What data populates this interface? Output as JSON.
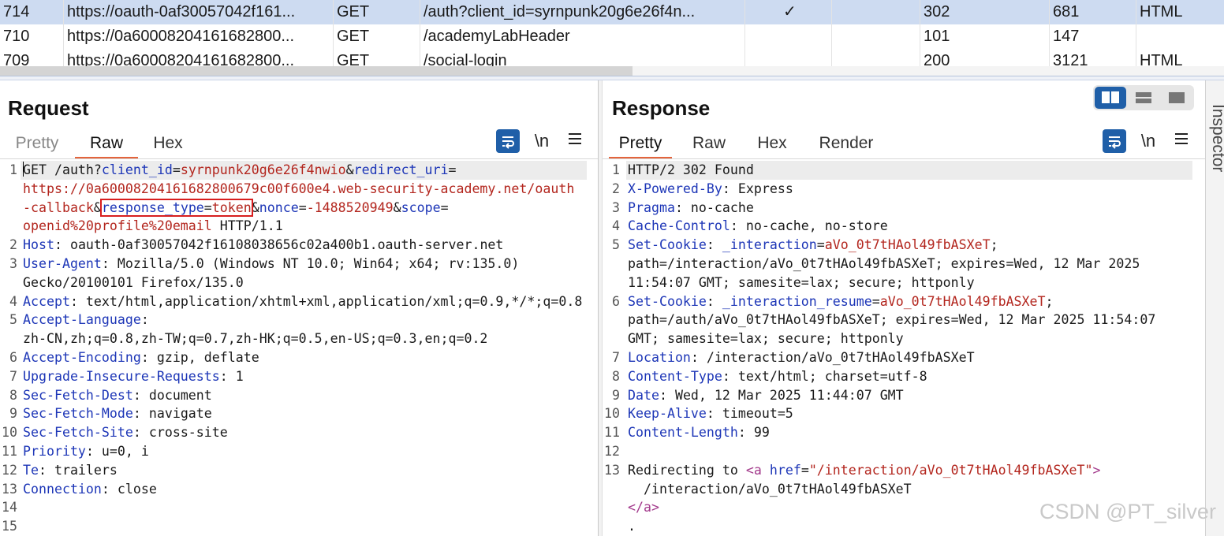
{
  "history": {
    "rows": [
      {
        "num": "714",
        "host": "https://oauth-0af30057042f161...",
        "method": "GET",
        "url": "/auth?client_id=syrnpunk20g6e26f4n...",
        "edited": "✓",
        "status": "302",
        "length": "681",
        "mime": "HTML",
        "selected": true
      },
      {
        "num": "710",
        "host": "https://0a60008204161682800...",
        "method": "GET",
        "url": "/academyLabHeader",
        "edited": "",
        "status": "101",
        "length": "147",
        "mime": "",
        "selected": false
      },
      {
        "num": "709",
        "host": "https://0a60008204161682800...",
        "method": "GET",
        "url": "/social-login",
        "edited": "",
        "status": "200",
        "length": "3121",
        "mime": "HTML",
        "selected": false
      }
    ]
  },
  "request": {
    "title": "Request",
    "tabs": {
      "pretty": "Pretty",
      "raw": "Raw",
      "hex": "Hex"
    },
    "active_tab": "Raw",
    "newline_label": "\\n",
    "line_numbers": [
      "1",
      "2",
      "3",
      "4",
      "5",
      "6",
      "7",
      "8",
      "9",
      "10",
      "11",
      "12",
      "13",
      "14",
      "15"
    ],
    "line1": {
      "method": "GET /auth?",
      "k_client_id": "client_id",
      "eq1": "=",
      "v_client_id": "syrnpunk20g6e26f4nwio",
      "amp1": "&",
      "k_redirect_uri": "redirect_uri",
      "eq2": "=",
      "v_redirect_uri_a": "https://0a60008204161682800679c00f600e4.web-security-academy.net/oauth",
      "v_redirect_uri_b": "-callback",
      "amp2": "&",
      "k_response_type": "response_type",
      "eq3": "=",
      "v_response_type": "token",
      "amp3": "&",
      "k_nonce": "nonce",
      "eq4": "=",
      "v_nonce": "-1488520949",
      "amp4": "&",
      "k_scope": "scope",
      "eq5": "=",
      "v_scope": "openid%20profile%20email",
      "proto": " HTTP/1.1"
    },
    "headers": {
      "host_k": "Host",
      "host_v": ": oauth-0af30057042f16108038656c02a400b1.oauth-server.net",
      "ua_k": "User-Agent",
      "ua_v": ": Mozilla/5.0 (Windows NT 10.0; Win64; x64; rv:135.0)",
      "ua_v2": "Gecko/20100101 Firefox/135.0",
      "accept_k": "Accept",
      "accept_v": ": text/html,application/xhtml+xml,application/xml;q=0.9,*/*;q=0.8",
      "al_k": "Accept-Language",
      "al_v": ":",
      "al_v2": "zh-CN,zh;q=0.8,zh-TW;q=0.7,zh-HK;q=0.5,en-US;q=0.3,en;q=0.2",
      "ae_k": "Accept-Encoding",
      "ae_v": ": gzip, deflate",
      "uir_k": "Upgrade-Insecure-Requests",
      "uir_v": ": 1",
      "sfd_k": "Sec-Fetch-Dest",
      "sfd_v": ": document",
      "sfm_k": "Sec-Fetch-Mode",
      "sfm_v": ": navigate",
      "sfs_k": "Sec-Fetch-Site",
      "sfs_v": ": cross-site",
      "pri_k": "Priority",
      "pri_v": ": u=0, i",
      "te_k": "Te",
      "te_v": ": trailers",
      "conn_k": "Connection",
      "conn_v": ": close"
    }
  },
  "response": {
    "title": "Response",
    "tabs": {
      "pretty": "Pretty",
      "raw": "Raw",
      "hex": "Hex",
      "render": "Render"
    },
    "active_tab": "Pretty",
    "newline_label": "\\n",
    "line_numbers": [
      "1",
      "2",
      "3",
      "4",
      "5",
      "6",
      "7",
      "8",
      "9",
      "10",
      "11",
      "12",
      "13"
    ],
    "status_line": "HTTP/2 302 Found",
    "h2_k": "X-Powered-By",
    "h2_v": ": Express",
    "h3_k": "Pragma",
    "h3_v": ": no-cache",
    "h4_k": "Cache-Control",
    "h4_v": ": no-cache, no-store",
    "h5_k": "Set-Cookie",
    "h5_sep": ": ",
    "h5_ck": "_interaction",
    "h5_eq": "=",
    "h5_cv": "aVo_0t7tHAol49fbASXeT",
    "h5_semi": ";",
    "h5_l2": "path=/interaction/aVo_0t7tHAol49fbASXeT; expires=Wed, 12 Mar 2025",
    "h5_l3": "11:54:07 GMT; samesite=lax; secure; httponly",
    "h6_k": "Set-Cookie",
    "h6_sep": ": ",
    "h6_ck": "_interaction_resume",
    "h6_eq": "=",
    "h6_cv": "aVo_0t7tHAol49fbASXeT",
    "h6_semi": ";",
    "h6_l2": "path=/auth/aVo_0t7tHAol49fbASXeT; expires=Wed, 12 Mar 2025 11:54:07",
    "h6_l3": "GMT; samesite=lax; secure; httponly",
    "h7_k": "Location",
    "h7_v": ": /interaction/aVo_0t7tHAol49fbASXeT",
    "h8_k": "Content-Type",
    "h8_v": ": text/html; charset=utf-8",
    "h9_k": "Date",
    "h9_v": ": Wed, 12 Mar 2025 11:44:07 GMT",
    "h10_k": "Keep-Alive",
    "h10_v": ": timeout=5",
    "h11_k": "Content-Length",
    "h11_v": ": 99",
    "body_text": "Redirecting to ",
    "body_tag_open": "<a ",
    "body_attr": "href",
    "body_eq": "=",
    "body_href": "\"/interaction/aVo_0t7tHAol49fbASXeT\"",
    "body_close": ">",
    "body_l2": "  /interaction/aVo_0t7tHAol49fbASXeT",
    "body_end_tag": "</a>",
    "body_dot": "."
  },
  "inspector_label": "Inspector",
  "watermark": "CSDN @PT_silver",
  "colors": {
    "accent": "#1f5fa8",
    "tab_underline": "#e4643c",
    "header_name": "#1d36b7",
    "param_value": "#b3261e",
    "selected_row": "#cddbf1",
    "box_highlight": "#d81e1e"
  }
}
